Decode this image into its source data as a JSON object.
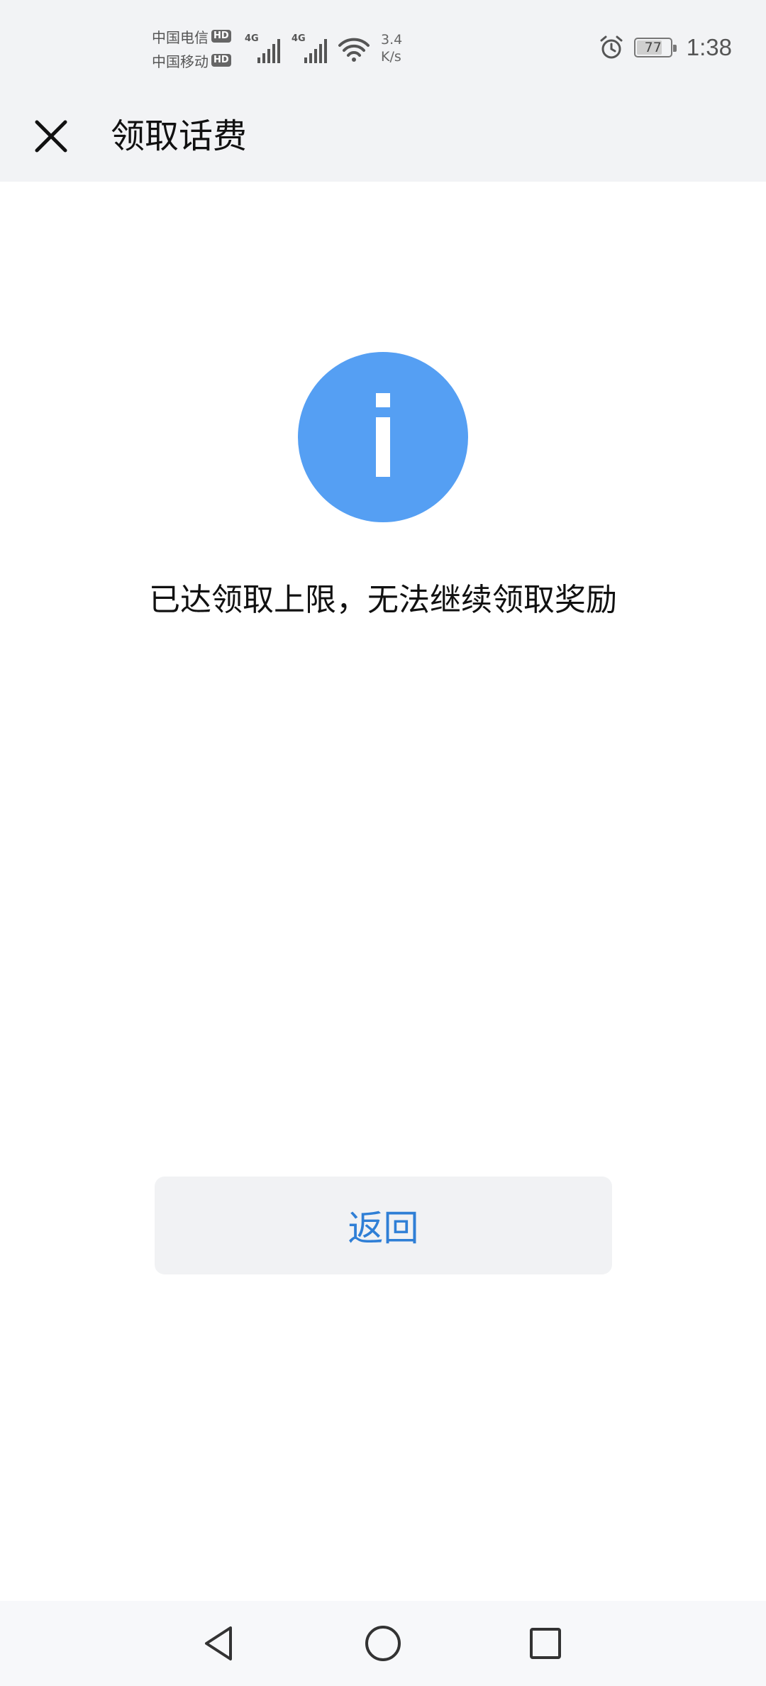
{
  "status_bar": {
    "carrier_1": "中国电信",
    "carrier_2": "中国移动",
    "hd_label": "HD",
    "net_type_1": "4G",
    "net_type_2": "4G",
    "net_speed_value": "3.4",
    "net_speed_unit": "K/s",
    "battery_level": "77",
    "battery_fraction": 0.77,
    "time": "1:38",
    "icons": [
      "signal-icon",
      "wifi-icon",
      "alarm-icon",
      "battery-icon"
    ]
  },
  "title_bar": {
    "title": "领取话费",
    "close_icon": "close-icon"
  },
  "content": {
    "icon": "info-icon",
    "icon_color": "#559ff3",
    "message": "已达领取上限，无法继续领取奖励"
  },
  "actions": {
    "back_label": "返回",
    "back_color": "#2f7fd6"
  },
  "nav_bar": {
    "icons": [
      "back-triangle-icon",
      "home-circle-icon",
      "recents-square-icon"
    ]
  }
}
